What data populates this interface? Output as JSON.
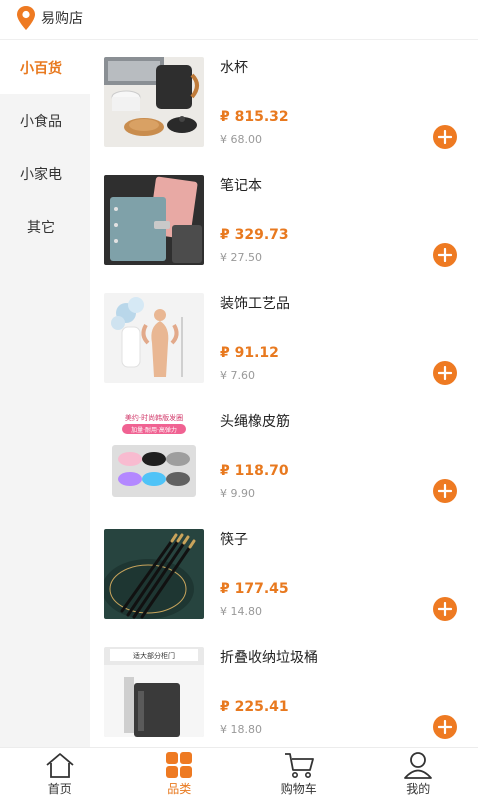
{
  "header": {
    "store_name": "易购店",
    "location_icon": "location-pin-icon"
  },
  "sidebar": {
    "items": [
      {
        "label": "小百货",
        "active": true
      },
      {
        "label": "小食品",
        "active": false
      },
      {
        "label": "小家电",
        "active": false
      },
      {
        "label": "其它",
        "active": false
      }
    ]
  },
  "products": [
    {
      "name": "水杯",
      "price": "₽ 815.32",
      "original": "¥ 68.00"
    },
    {
      "name": "笔记本",
      "price": "₽ 329.73",
      "original": "¥ 27.50"
    },
    {
      "name": "装饰工艺品",
      "price": "₽ 91.12",
      "original": "¥ 7.60"
    },
    {
      "name": "头绳橡皮筋",
      "price": "₽ 118.70",
      "original": "¥ 9.90"
    },
    {
      "name": "筷子",
      "price": "₽ 177.45",
      "original": "¥ 14.80"
    },
    {
      "name": "折叠收纳垃圾桶",
      "price": "₽ 225.41",
      "original": "¥ 18.80"
    }
  ],
  "product_images": {
    "p3_caption": "",
    "p4_banner_1": "美约·时尚韩版发圈",
    "p4_banner_2": "加量·耐用·高弹力",
    "p6_banner": "适大部分柜门"
  },
  "tabbar": {
    "items": [
      {
        "label": "首页",
        "icon": "home-icon"
      },
      {
        "label": "品类",
        "icon": "category-grid-icon"
      },
      {
        "label": "购物车",
        "icon": "cart-icon"
      },
      {
        "label": "我的",
        "icon": "user-icon"
      }
    ],
    "active_index": 1
  },
  "colors": {
    "accent": "#e8791f",
    "button": "#ee7a22",
    "sidebar_bg": "#f4f4f4"
  }
}
